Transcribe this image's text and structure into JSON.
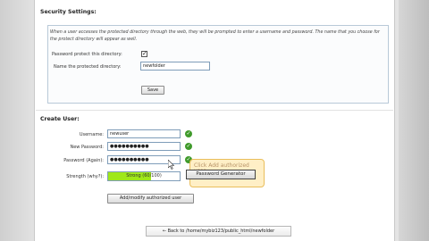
{
  "security": {
    "title": "Security Settings:",
    "description": "When a user accesses the protected directory through the web, they will be prompted to enter a username and password. The name that you choose for the protect directory will appear as well.",
    "protect_label": "Password protect this directory:",
    "protect_checked": true,
    "name_label": "Name the protected directory:",
    "name_value": "newfolder",
    "save_label": "Save"
  },
  "create_user": {
    "title": "Create User:",
    "username_label": "Username:",
    "username_value": "newuser",
    "password_label": "New Password:",
    "password_value": "●●●●●●●●●●",
    "password_again_label": "Password (Again):",
    "password_again_value": "●●●●●●●●●●",
    "strength_label": "Strength",
    "strength_help": "(why?)",
    "strength_text": "Strong (60/100)",
    "strength_value": 60,
    "strength_max": 100,
    "tooltip_text": "Click Add authorized user",
    "generator_label": "Password Generator",
    "add_label": "Add/modify authorized user"
  },
  "back_link": "← Back to /home/mybiz123/public_html/newfolder",
  "colors": {
    "strength_fill": "#9fe81a",
    "ok": "#3f9a2b",
    "tooltip": "#ffeec2"
  },
  "icons": [
    "check-icon",
    "cursor-icon"
  ]
}
